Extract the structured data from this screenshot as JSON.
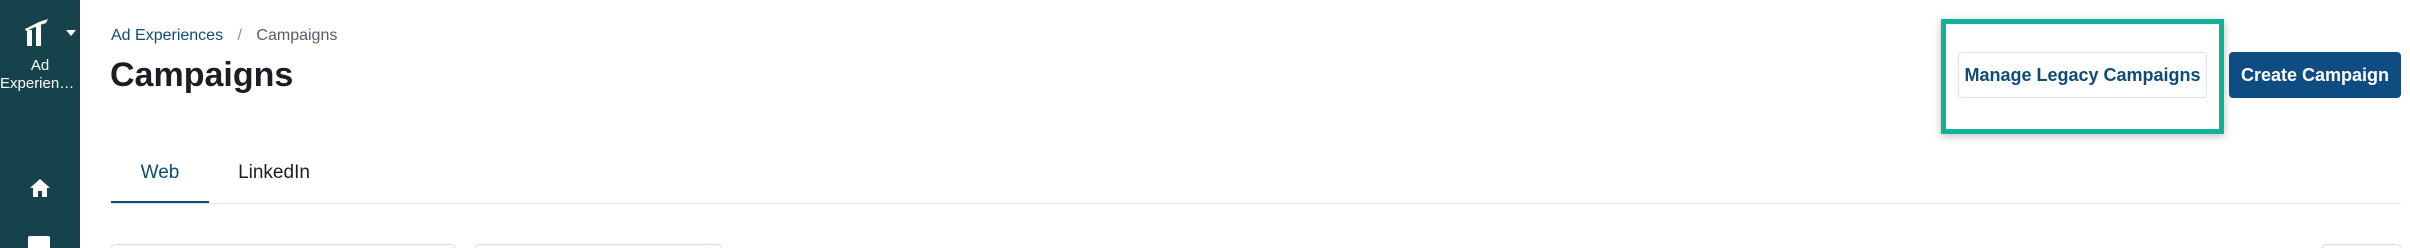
{
  "sidebar": {
    "app_name_line1": "Ad",
    "app_name_line2": "Experiences",
    "logo_icon": "bar-chart-logo-icon",
    "caret_icon": "chevron-down-icon",
    "home_icon": "home-icon",
    "colors": {
      "background": "#16424c",
      "foreground": "#ffffff"
    }
  },
  "breadcrumb": {
    "parent": "Ad Experiences",
    "separator": "/",
    "current": "Campaigns"
  },
  "page": {
    "title": "Campaigns"
  },
  "actions": {
    "legacy_label": "Manage Legacy Campaigns",
    "create_label": "Create Campaign",
    "highlight_color": "#11b394",
    "primary_color": "#0f4c81"
  },
  "tabs": [
    {
      "label": "Web",
      "active": true
    },
    {
      "label": "LinkedIn",
      "active": false
    }
  ]
}
